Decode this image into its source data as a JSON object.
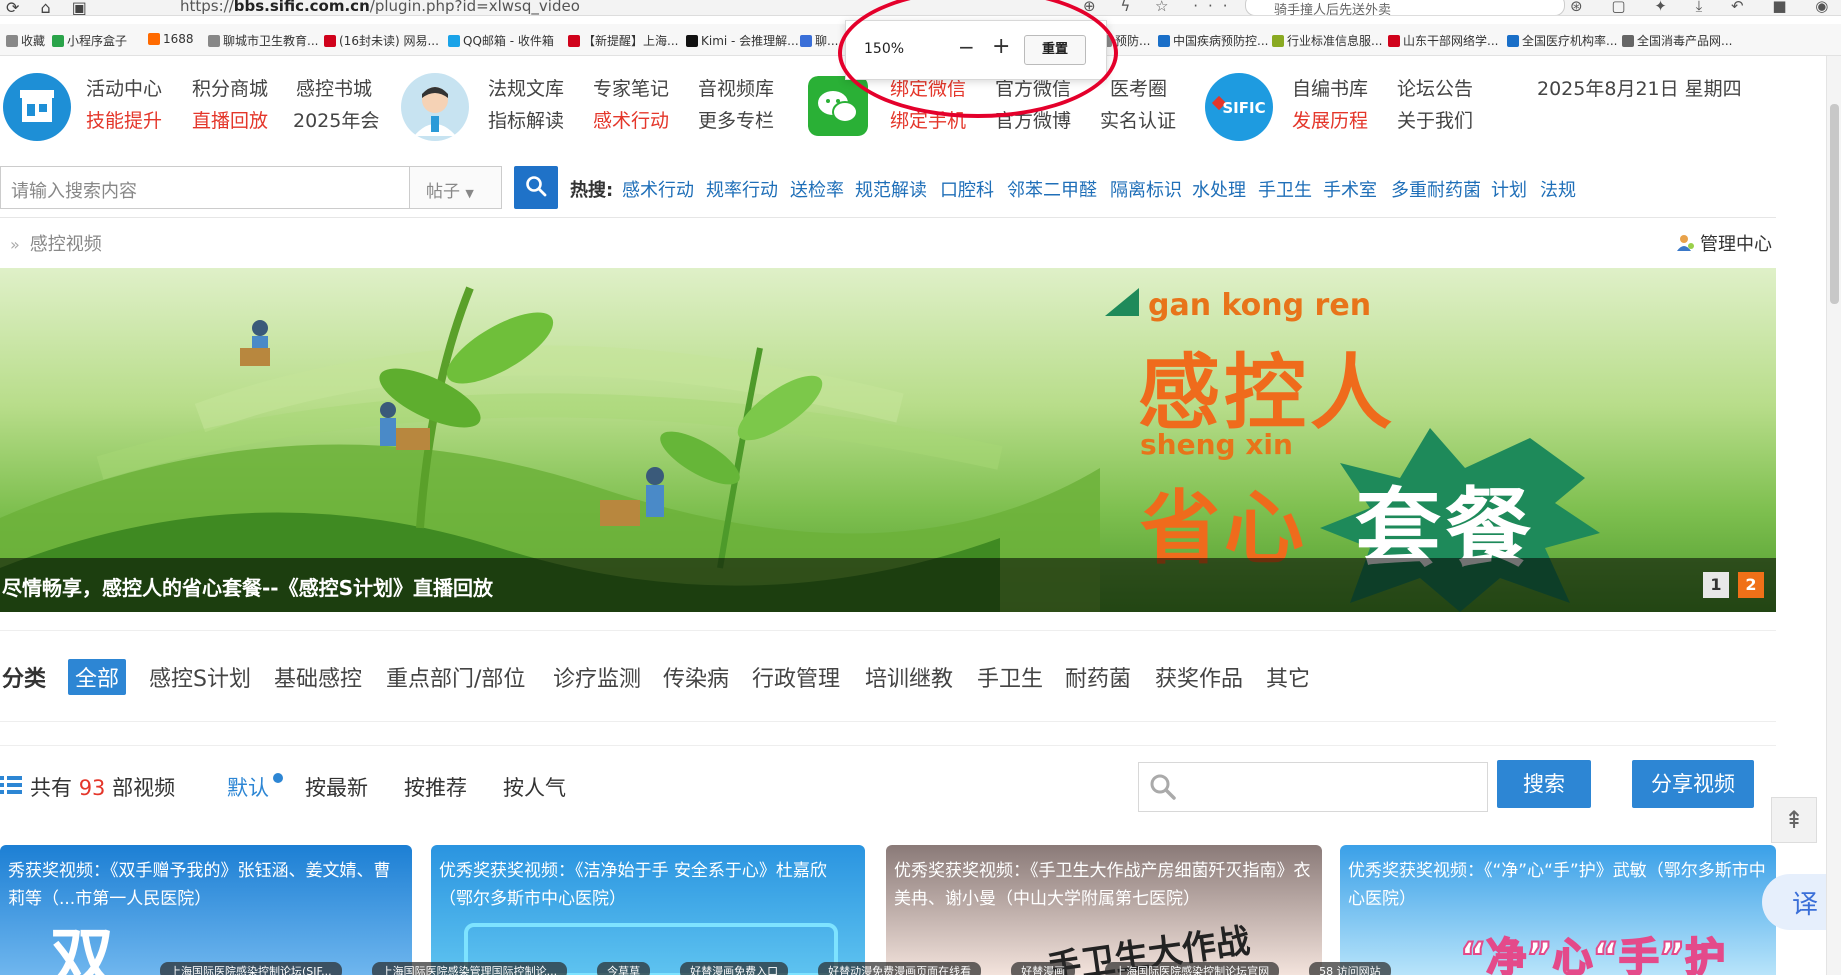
{
  "browser": {
    "url_prefix": "https://",
    "url_domain": "bbs.sific.com.cn",
    "url_path": "/plugin.php?id=xlwsq_video",
    "search_text": "骑手撞人后先送外卖",
    "bookmarks": [
      {
        "label": "收藏",
        "color": "#888888"
      },
      {
        "label": "小程序盒子",
        "color": "#2aa44a"
      },
      {
        "label": "1688",
        "color": "#ff6a00"
      },
      {
        "label": "聊城市卫生教育...",
        "color": "#888888"
      },
      {
        "label": "(16封未读) 网易...",
        "color": "#d0021b"
      },
      {
        "label": "QQ邮箱 - 收件箱",
        "color": "#1aa3e8"
      },
      {
        "label": "【新提醒】上海...",
        "color": "#d0021b"
      },
      {
        "label": "Kimi - 会推理解...",
        "color": "#111111"
      },
      {
        "label": "聊...",
        "color": "#3a6fd8"
      },
      {
        "label": "预防...",
        "color": "#888888"
      },
      {
        "label": "中国疾病预防控...",
        "color": "#1a6fc8"
      },
      {
        "label": "行业标准信息服...",
        "color": "#8aaa22"
      },
      {
        "label": "山东干部网络学...",
        "color": "#d0021b"
      },
      {
        "label": "全国医疗机构率...",
        "color": "#1a6fc8"
      },
      {
        "label": "全国消毒产品网...",
        "color": "#666666"
      }
    ],
    "zoom": {
      "percent": "150%",
      "minus": "−",
      "plus": "+",
      "reset": "重置"
    }
  },
  "nav": {
    "group1": [
      "活动中心",
      "积分商城",
      "感控书城",
      "技能提升",
      "直播回放",
      "2025年会"
    ],
    "group2": [
      "法规文库",
      "专家笔记",
      "音视频库",
      "指标解读",
      "感术行动",
      "更多专栏"
    ],
    "group3": [
      "绑定微信",
      "官方微信",
      "医考圈",
      "绑定手机",
      "官方微博",
      "实名认证"
    ],
    "group4": [
      "自编书库",
      "论坛公告",
      "发展历程",
      "关于我们"
    ],
    "logo_text": "SIFIC",
    "date": "2025年8月21日 星期四"
  },
  "search": {
    "placeholder": "请输入搜索内容",
    "select": "帖子",
    "hot_label": "热搜:",
    "hot": [
      "感术行动",
      "规率行动",
      "送检率",
      "规范解读",
      "口腔科",
      "邻苯二甲醛",
      "隔离标识",
      "水处理",
      "手卫生",
      "手术室",
      "多重耐药菌",
      "计划",
      "法规"
    ]
  },
  "breadcrumb": {
    "sep": "»",
    "current": "感控视频"
  },
  "manage": "管理中心",
  "banner": {
    "caption": "尽情畅享，感控人的省心套餐--《感控S计划》直播回放",
    "pinyin1": "gan kong ren",
    "big1": "感控人",
    "pinyin2": "sheng xin",
    "big2": "省心",
    "big3": "套餐",
    "pages": [
      "1",
      "2"
    ]
  },
  "categories": {
    "label": "分类",
    "items": [
      "全部",
      "感控S计划",
      "基础感控",
      "重点部门/部位",
      "诊疗监测",
      "传染病",
      "行政管理",
      "培训继教",
      "手卫生",
      "耐药菌",
      "获奖作品",
      "其它"
    ]
  },
  "sortbar": {
    "total_prefix": "共有",
    "total_count": "93",
    "total_suffix": "部视频",
    "sorts": [
      "默认",
      "按最新",
      "按推荐",
      "按人气"
    ],
    "search_btn": "搜索",
    "share_btn": "分享视频"
  },
  "cards": [
    {
      "title": "秀获奖视频：《双手赠予我的》张钰涵、姜文婧、曹莉等（...市第一人民医院）",
      "deco": "双",
      "bg": "#1c7fd4"
    },
    {
      "title": "优秀奖获奖视频：《洁净始于手 安全系于心》杜嘉欣（鄂尔多斯市中心医院）",
      "deco": "",
      "bg": "#2a94e0"
    },
    {
      "title": "优秀奖获奖视频：《手卫生大作战产房细菌歼灭指南》衣美冉、谢小曼（中山大学附属第七医院）",
      "deco": "手卫生大作战",
      "bg": "#e8d0c8"
    },
    {
      "title": "优秀奖获奖视频：《“净”心“手”护》武敏（鄂尔多斯市中心医院）",
      "deco": "“净”心“手”护",
      "bg": "#3aa0e8"
    }
  ],
  "taskbar": [
    "上海国际医院感染控制论坛(SIF...",
    "上海国际医院感染管理国际控制论...",
    "今草草",
    "好替漫画免费入口",
    "好替动漫免费漫画页面在线看",
    "好替漫画",
    "上海国际医院感染控制论坛官网",
    "58 访问网站"
  ],
  "translate": "译",
  "to_top": "⇞"
}
